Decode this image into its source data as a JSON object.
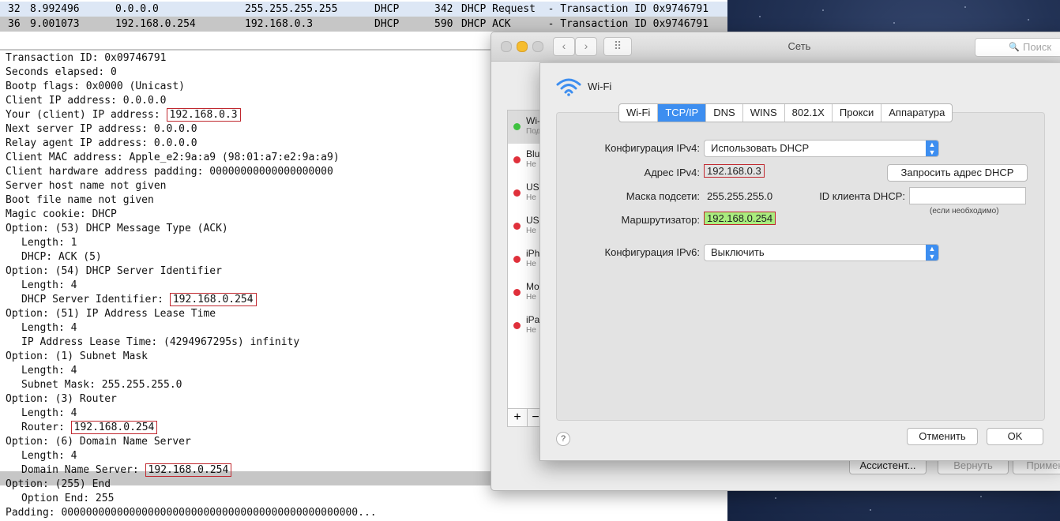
{
  "packets": [
    {
      "no": "32",
      "time": "8.992496",
      "src": "0.0.0.0",
      "dst": "255.255.255.255",
      "proto": "DHCP",
      "len": "342",
      "info": "DHCP Request  - Transaction ID 0x9746791"
    },
    {
      "no": "36",
      "time": "9.001073",
      "src": "192.168.0.254",
      "dst": "192.168.0.3",
      "proto": "DHCP",
      "len": "590",
      "info": "DHCP ACK      - Transaction ID 0x9746791"
    }
  ],
  "details": {
    "l01": "Transaction ID: 0x09746791",
    "l02": "Seconds elapsed: 0",
    "l03": "Bootp flags: 0x0000 (Unicast)",
    "l04": "Client IP address: 0.0.0.0",
    "l05_label": "Your (client) IP address: ",
    "l05_value": "192.168.0.3",
    "l06": "Next server IP address: 0.0.0.0",
    "l07": "Relay agent IP address: 0.0.0.0",
    "l08": "Client MAC address: Apple_e2:9a:a9 (98:01:a7:e2:9a:a9)",
    "l09": "Client hardware address padding: 00000000000000000000",
    "l10": "Server host name not given",
    "l11": "Boot file name not given",
    "l12": "Magic cookie: DHCP",
    "l13": "Option: (53) DHCP Message Type (ACK)",
    "l14": "Length: 1",
    "l15": "DHCP: ACK (5)",
    "l16": "Option: (54) DHCP Server Identifier",
    "l17": "Length: 4",
    "l18_label": "DHCP Server Identifier: ",
    "l18_value": "192.168.0.254",
    "l19": "Option: (51) IP Address Lease Time",
    "l20": "Length: 4",
    "l21": "IP Address Lease Time: (4294967295s) infinity",
    "l22": "Option: (1) Subnet Mask",
    "l23": "Length: 4",
    "l24": "Subnet Mask: 255.255.255.0",
    "l25": "Option: (3) Router",
    "l26": "Length: 4",
    "l27_label": "Router: ",
    "l27_value": "192.168.0.254",
    "l28": "Option: (6) Domain Name Server",
    "l29": "Length: 4",
    "l30_label": "Domain Name Server: ",
    "l30_value": "192.168.0.254",
    "l31": "Option: (255) End",
    "l32": "Option End: 255",
    "l33": "Padding: 000000000000000000000000000000000000000000000000..."
  },
  "window": {
    "title": "Сеть",
    "search_placeholder": "Поиск",
    "services": [
      {
        "name": "Wi-",
        "sub": "Под",
        "status": "green"
      },
      {
        "name": "Blu",
        "sub": "Не",
        "status": "red"
      },
      {
        "name": "US",
        "sub": "Не",
        "status": "red"
      },
      {
        "name": "US",
        "sub": "Не",
        "status": "red"
      },
      {
        "name": "iPh",
        "sub": "Не",
        "status": "red"
      },
      {
        "name": "Mo",
        "sub": "Не",
        "status": "red"
      },
      {
        "name": "iPa",
        "sub": "Не",
        "status": "red"
      }
    ],
    "plus": "+",
    "minus": "−",
    "assistant": "Ассистент...",
    "revert": "Вернуть",
    "apply": "Примен"
  },
  "sheet": {
    "interface": "Wi-Fi",
    "tabs": [
      "Wi-Fi",
      "TCP/IP",
      "DNS",
      "WINS",
      "802.1X",
      "Прокси",
      "Аппаратура"
    ],
    "ipv4_config_label": "Конфигурация IPv4:",
    "ipv4_config_value": "Использовать DHCP",
    "ipv4_addr_label": "Адрес IPv4:",
    "ipv4_addr_value": "192.168.0.3",
    "renew_button": "Запросить адрес DHCP",
    "subnet_label": "Маска подсети:",
    "subnet_value": "255.255.255.0",
    "client_id_label": "ID клиента DHCP:",
    "client_id_value": "",
    "client_id_hint": "(если необходимо)",
    "router_label": "Маршрутизатор:",
    "router_value": "192.168.0.254",
    "ipv6_config_label": "Конфигурация IPv6:",
    "ipv6_config_value": "Выключить",
    "cancel": "Отменить",
    "ok": "OK",
    "help": "?"
  },
  "colors": {
    "highlight_border": "#c0282f",
    "router_fill": "#a9ec7e",
    "accent": "#3d8ef0"
  }
}
